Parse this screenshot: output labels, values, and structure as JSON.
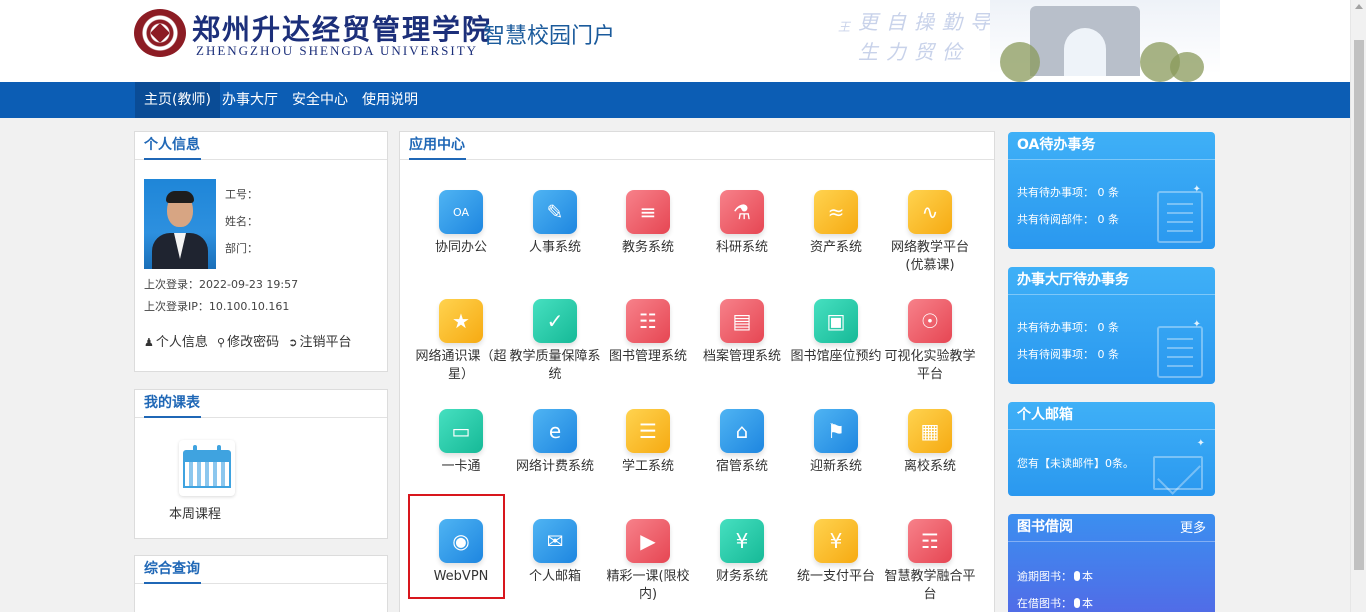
{
  "header": {
    "school_cn": "郑州升达经贸管理学院",
    "school_en": "ZHENGZHOU SHENGDA UNIVERSITY",
    "portal_title": "智慧校园门户",
    "motto_line1": "更自操勤导",
    "motto_line2": "生力贸俭",
    "motto_side": "王"
  },
  "nav": {
    "items": [
      "主页(教师)",
      "办事大厅",
      "安全中心",
      "使用说明"
    ]
  },
  "profile": {
    "title": "个人信息",
    "staff_no_label": "工号：",
    "name_label": "姓名：",
    "dept_label": "部门：",
    "last_login": "上次登录：2022-09-23 19:57",
    "last_ip": "上次登录IP：10.100.10.161",
    "link_info": "个人信息",
    "link_password": "修改密码",
    "link_logout": "注销平台"
  },
  "schedule": {
    "title": "我的课表",
    "item_label": "本周课程"
  },
  "query": {
    "title": "综合查询"
  },
  "apps": {
    "title": "应用中心",
    "items": [
      {
        "label": "协同办公",
        "icon": "oa-icon",
        "color": "blue"
      },
      {
        "label": "人事系统",
        "icon": "personnel-icon",
        "color": "blue"
      },
      {
        "label": "教务系统",
        "icon": "book-icon",
        "color": "red"
      },
      {
        "label": "科研系统",
        "icon": "microscope-icon",
        "color": "red"
      },
      {
        "label": "资产系统",
        "icon": "asset-icon",
        "color": "yellow"
      },
      {
        "label": "网络教学平台(优慕课)",
        "icon": "teaching-platform-icon",
        "color": "yellow"
      },
      {
        "label": "网络通识课（超星）",
        "icon": "chaoxing-icon",
        "color": "yellow"
      },
      {
        "label": "教学质量保障系统",
        "icon": "quality-icon",
        "color": "teal"
      },
      {
        "label": "图书管理系统",
        "icon": "library-icon",
        "color": "red"
      },
      {
        "label": "档案管理系统",
        "icon": "archive-icon",
        "color": "red"
      },
      {
        "label": "图书馆座位预约",
        "icon": "seat-icon",
        "color": "teal"
      },
      {
        "label": "可视化实验教学平台",
        "icon": "lab-icon",
        "color": "red"
      },
      {
        "label": "一卡通",
        "icon": "card-icon",
        "color": "teal"
      },
      {
        "label": "网络计费系统",
        "icon": "network-billing-icon",
        "color": "blue"
      },
      {
        "label": "学工系统",
        "icon": "student-affairs-icon",
        "color": "yellow"
      },
      {
        "label": "宿管系统",
        "icon": "dormitory-icon",
        "color": "blue"
      },
      {
        "label": "迎新系统",
        "icon": "welcome-icon",
        "color": "blue"
      },
      {
        "label": "离校系统",
        "icon": "leave-school-icon",
        "color": "yellow"
      },
      {
        "label": "WebVPN",
        "icon": "webvpn-icon",
        "color": "blue"
      },
      {
        "label": "个人邮箱",
        "icon": "mail-icon",
        "color": "blue"
      },
      {
        "label": "精彩一课(限校内)",
        "icon": "video-lesson-icon",
        "color": "red"
      },
      {
        "label": "财务系统",
        "icon": "finance-icon",
        "color": "teal"
      },
      {
        "label": "统一支付平台",
        "icon": "payment-icon",
        "color": "yellow"
      },
      {
        "label": "智慧教学融合平台",
        "icon": "smart-teaching-icon",
        "color": "red"
      }
    ]
  },
  "cards": {
    "oa": {
      "title": "OA待办事务",
      "line1": "共有待办事项： 0 条",
      "line2": "共有待阅部件： 0 条"
    },
    "hall": {
      "title": "办事大厅待办事务",
      "line1": "共有待办事项： 0 条",
      "line2": "共有待阅事项： 0 条"
    },
    "mail": {
      "title": "个人邮箱",
      "line1": "您有【未读邮件】0条。"
    },
    "library": {
      "title": "图书借阅",
      "more": "更多",
      "line1": "逾期图书：",
      "line1_suffix": "本",
      "line2": "在借图书：",
      "line2_suffix": "本"
    }
  },
  "colors": {
    "nav": "#0c5db4",
    "nav_active": "#0a4c96",
    "accent_title": "#1f67b6",
    "highlight_box": "#d8161d",
    "card_blue": "#2a98ef",
    "card_violet": "#5368e6"
  }
}
